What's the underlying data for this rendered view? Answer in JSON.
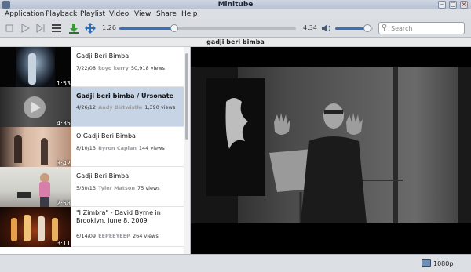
{
  "window": {
    "title": "Minitube"
  },
  "menu": [
    "Application",
    "Playback",
    "Playlist",
    "Video",
    "View",
    "Share",
    "Help"
  ],
  "toolbar": {
    "current_time": "1:26",
    "total_time": "4:34",
    "progress": 0.31,
    "volume": 0.85,
    "search_placeholder": "Search"
  },
  "playlist": {
    "header": "gadji beri bimba",
    "items": [
      {
        "title": "Gadji Beri Bimba",
        "date": "7/22/08",
        "author": "koyo kerry",
        "views": "50,918 views",
        "duration": "1:53"
      },
      {
        "title": "Gadji beri bimba / Ursonate",
        "date": "4/26/12",
        "author": "Andy Birtwistle",
        "views": "1,390 views",
        "duration": "4:35"
      },
      {
        "title": "O Gadji Beri Bimba",
        "date": "8/10/13",
        "author": "Byron Caplan",
        "views": "144 views",
        "duration": "3:42"
      },
      {
        "title": "Gadji Beri Bimba",
        "date": "5/30/13",
        "author": "Tyler Matson",
        "views": "75 views",
        "duration": "2:58"
      },
      {
        "title": "\"I Zimbra\" - David Byrne in Brooklyn, June 8, 2009",
        "date": "6/14/09",
        "author": "EEPEEYEEP",
        "views": "264 views",
        "duration": "3:11"
      }
    ]
  },
  "status": {
    "quality": "1080p"
  }
}
